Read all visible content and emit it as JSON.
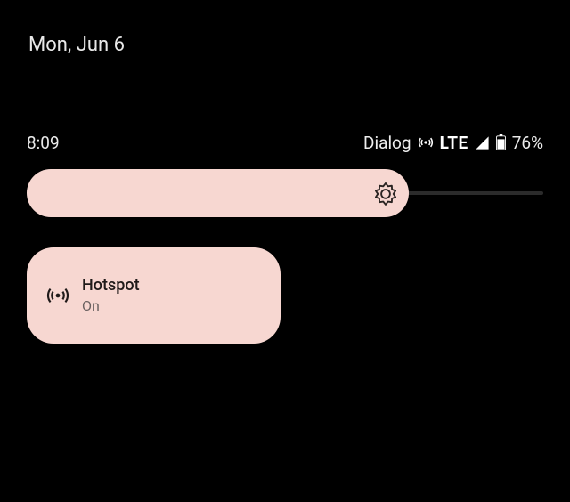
{
  "date": "Mon, Jun 6",
  "status": {
    "clock": "8:09",
    "carrier": "Dialog",
    "network_type": "LTE",
    "battery_pct": "76%"
  },
  "brightness": {
    "level_pct": 74
  },
  "tiles": {
    "hotspot": {
      "title": "Hotspot",
      "subtitle": "On"
    }
  },
  "colors": {
    "accent": "#f7d7d1"
  }
}
